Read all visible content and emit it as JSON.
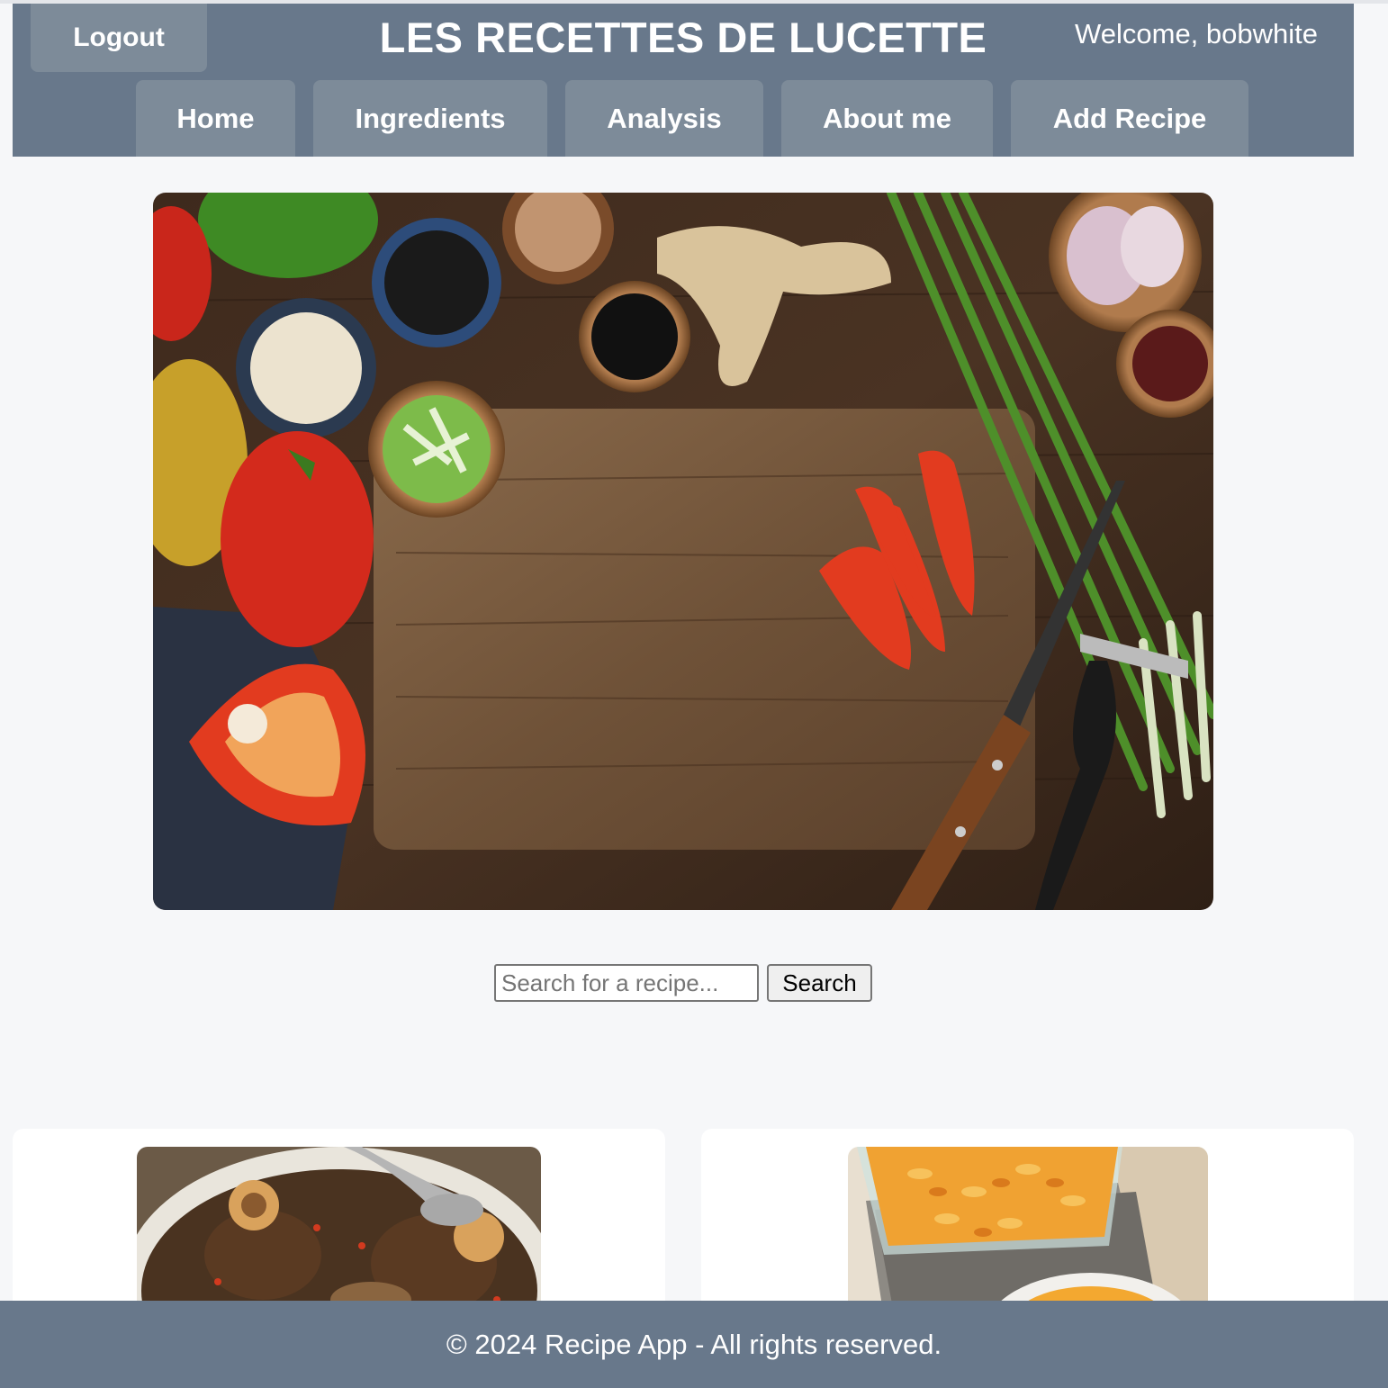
{
  "header": {
    "logout_label": "Logout",
    "title": "LES RECETTES DE LUCETTE",
    "welcome": "Welcome, bobwhite"
  },
  "nav": {
    "items": [
      {
        "label": "Home"
      },
      {
        "label": "Ingredients"
      },
      {
        "label": "Analysis"
      },
      {
        "label": "About me"
      },
      {
        "label": "Add Recipe"
      }
    ]
  },
  "hero": {
    "image": "cutting-board-with-vegetables-photo"
  },
  "search": {
    "placeholder": "Search for a recipe...",
    "button_label": "Search"
  },
  "recipes": [
    {
      "image": "osso-buco-stew-photo"
    },
    {
      "image": "mac-and-cheese-photo"
    }
  ],
  "footer": {
    "text": "© 2024 Recipe App - All rights reserved."
  },
  "colors": {
    "header_bg": "#68788b",
    "button_bg": "#7d8b99",
    "page_bg": "#f6f7f9"
  }
}
